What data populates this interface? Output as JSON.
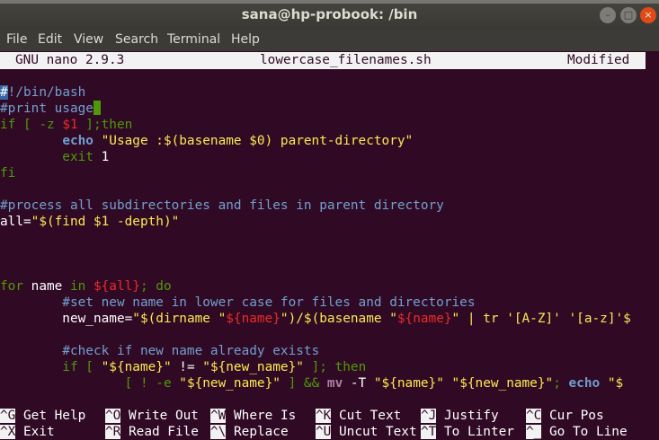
{
  "window": {
    "title": "sana@hp-probook: /bin",
    "min_glyph": "–",
    "max_glyph": "□",
    "close_glyph": "×"
  },
  "menu": [
    "File",
    "Edit",
    "View",
    "Search",
    "Terminal",
    "Help"
  ],
  "nano": {
    "version": "GNU nano 2.9.3",
    "filename": "lowercase_filenames.sh",
    "status": "Modified"
  },
  "code": {
    "l1_hash": "#",
    "l1_rest": "!/bin/bash",
    "l2": "#print usage",
    "l3_if": "if [ -z ",
    "l3_var": "$1",
    "l3_then": " ];then",
    "l4_indent": "        ",
    "l4_echo": "echo",
    "l4_str": " \"Usage :$(basename $0) parent-directory\"",
    "l5_exit": "        exit",
    "l5_num": " 1",
    "l6": "fi",
    "l8": "#process all subdirectories and files in parent directory",
    "l9_name": "all=",
    "l9_str": "\"$(find $1 -depth)\"",
    "l13_for": "for",
    "l13_name": " name ",
    "l13_in": "in",
    "l13_sp": " ",
    "l13_var": "${all}",
    "l13_do": "; do",
    "l14": "        #set new name in lower case for files and directories",
    "l15_a": "        new_name=",
    "l15_b": "\"$(dirname \"",
    "l15_c": "${name}",
    "l15_d": "\")/$(basename \"",
    "l15_e": "${name}",
    "l15_f": "\" | tr '[A-Z]' '[a-z]'$",
    "l17": "        #check if new name already exists",
    "l18_if": "        if [ ",
    "l18_a": "\"${name}\"",
    "l18_ne": " != ",
    "l18_b": "\"${new_name}\"",
    "l18_then": " ]; then",
    "l19_a": "                [ ! -e ",
    "l19_b": "\"${new_name}\"",
    "l19_c": " ] && ",
    "l19_mv": "mv",
    "l19_d": " -T ",
    "l19_e": "\"${name}\"",
    "l19_f": " ",
    "l19_g": "\"${new_name}\"",
    "l19_h": "; ",
    "l19_echo": "echo",
    "l19_i": " \"$"
  },
  "shortcuts": {
    "row1": [
      {
        "key": "^G",
        "label": " Get Help"
      },
      {
        "key": "^O",
        "label": " Write Out"
      },
      {
        "key": "^W",
        "label": " Where Is"
      },
      {
        "key": "^K",
        "label": " Cut Text"
      },
      {
        "key": "^J",
        "label": " Justify"
      },
      {
        "key": "^C",
        "label": " Cur Pos"
      }
    ],
    "row2": [
      {
        "key": "^X",
        "label": " Exit"
      },
      {
        "key": "^R",
        "label": " Read File"
      },
      {
        "key": "^\\",
        "label": " Replace"
      },
      {
        "key": "^U",
        "label": " Uncut Text"
      },
      {
        "key": "^T",
        "label": " To Linter"
      },
      {
        "key": "^_",
        "label": " Go To Line"
      }
    ]
  }
}
